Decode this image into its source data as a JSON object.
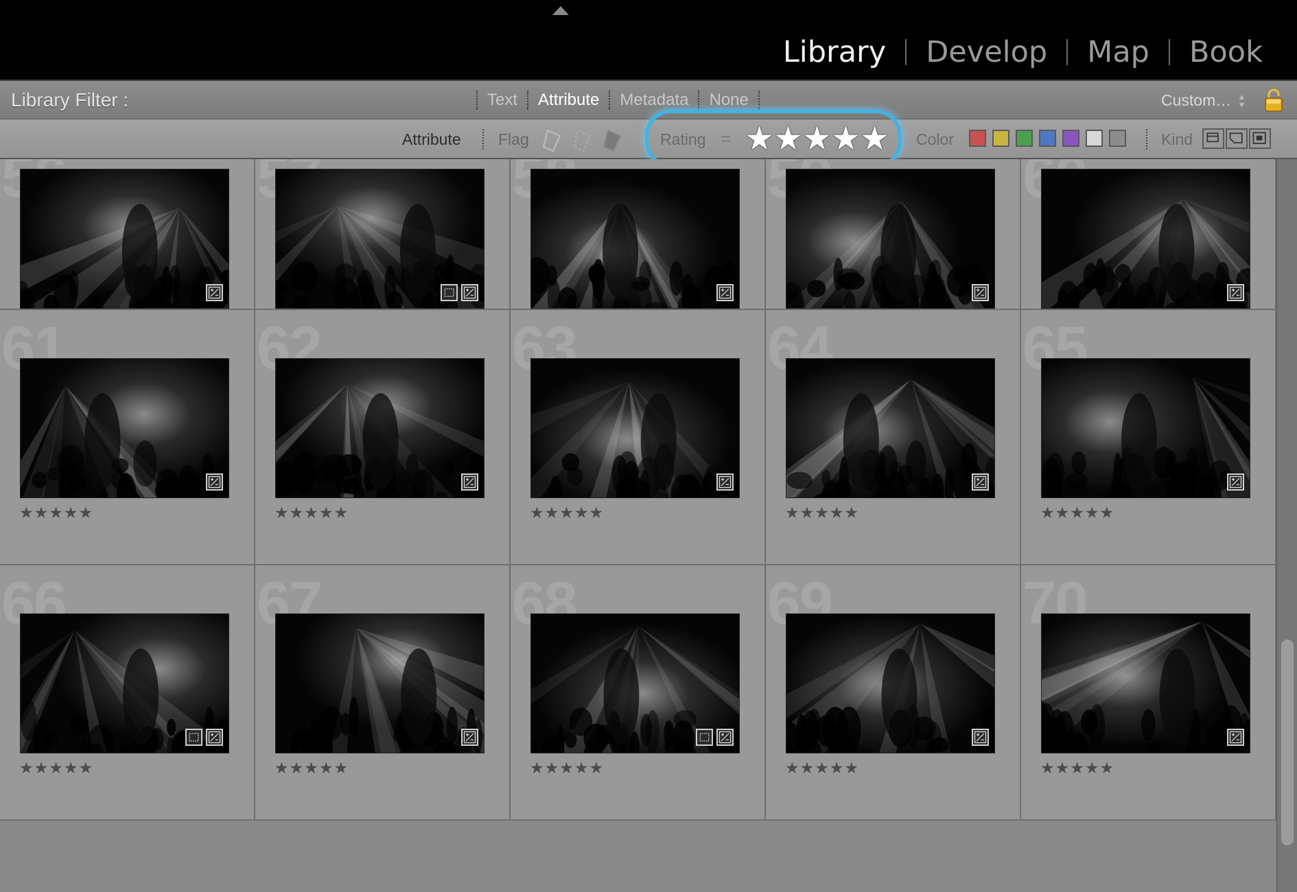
{
  "modules": [
    "Library",
    "Develop",
    "Map",
    "Book"
  ],
  "active_module": "Library",
  "filter_bar": {
    "title": "Library Filter :",
    "tabs": [
      "Text",
      "Attribute",
      "Metadata",
      "None"
    ],
    "active_tab": "Attribute",
    "preset": "Custom…"
  },
  "attribute_bar": {
    "attribute_label": "Attribute",
    "flag_label": "Flag",
    "rating_label": "Rating",
    "rating_operator": "=",
    "rating_value": 5,
    "rating_stars": "★★★★★",
    "color_label": "Color",
    "color_swatches": [
      "#c85250",
      "#c8b540",
      "#4aa04e",
      "#4f78c4",
      "#8a55c0",
      "#d8d8d8",
      "#8c8c8c"
    ],
    "kind_label": "Kind",
    "kind_icons": [
      "master-photos-icon",
      "virtual-copies-icon",
      "videos-icon"
    ],
    "highlight_color": "#3fb4e6"
  },
  "grid": {
    "rows": [
      [
        {
          "number": "56",
          "stars": "★★★★★",
          "badges": [
            "edit"
          ]
        },
        {
          "number": "57",
          "stars": "★★★★★",
          "badges": [
            "crop",
            "edit"
          ]
        },
        {
          "number": "58",
          "stars": "★★★★★",
          "badges": [
            "edit"
          ]
        },
        {
          "number": "59",
          "stars": "★★★★★",
          "badges": [
            "edit"
          ]
        },
        {
          "number": "60",
          "stars": "★★★★★",
          "badges": [
            "edit"
          ]
        }
      ],
      [
        {
          "number": "61",
          "stars": "★★★★★",
          "badges": [
            "edit"
          ]
        },
        {
          "number": "62",
          "stars": "★★★★★",
          "badges": [
            "edit"
          ]
        },
        {
          "number": "63",
          "stars": "★★★★★",
          "badges": [
            "edit"
          ]
        },
        {
          "number": "64",
          "stars": "★★★★★",
          "badges": [
            "edit"
          ]
        },
        {
          "number": "65",
          "stars": "★★★★★",
          "badges": [
            "edit"
          ]
        }
      ],
      [
        {
          "number": "66",
          "stars": "★★★★★",
          "badges": [
            "crop",
            "edit"
          ]
        },
        {
          "number": "67",
          "stars": "★★★★★",
          "badges": [
            "edit"
          ]
        },
        {
          "number": "68",
          "stars": "★★★★★",
          "badges": [
            "crop",
            "edit"
          ]
        },
        {
          "number": "69",
          "stars": "★★★★★",
          "badges": [
            "edit"
          ]
        },
        {
          "number": "70",
          "stars": "★★★★★",
          "badges": [
            "edit"
          ]
        }
      ]
    ]
  }
}
